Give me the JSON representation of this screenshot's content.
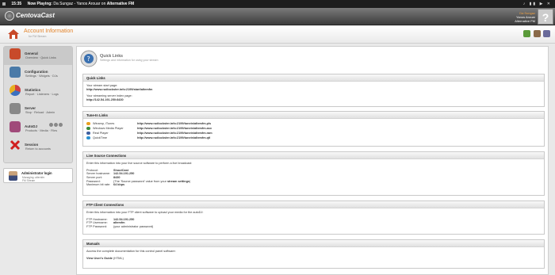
{
  "topbar": {
    "time": "15:35",
    "now_playing_label": "Now Playing:",
    "track": "Da Sungaz - Yanos Arouar on",
    "station": "Alternative FM"
  },
  "header": {
    "logo": "CentovaCast",
    "user_line1": "Da Sungaz",
    "user_line2": "Yanos Arouar",
    "user_line3": "Alternative FM",
    "help": "?"
  },
  "titlebar": {
    "title": "Account Information",
    "subtitle": "for FM Stream"
  },
  "sidebar": {
    "items": [
      {
        "title": "General",
        "links": "Overview  ·  Quick Links"
      },
      {
        "title": "Configuration",
        "links": "Settings  ·  Widgets  ·  DJs"
      },
      {
        "title": "Statistics",
        "links": "Report  ·  Listeners  ·  Logs"
      },
      {
        "title": "Server",
        "links": "Stop  ·  Reload  ·  Admin"
      },
      {
        "title": "AutoDJ",
        "links": "Products  ·  Media  ·  Files"
      },
      {
        "title": "Session",
        "links": "Return to accounts"
      }
    ]
  },
  "admin": {
    "title": "Administrator login",
    "line1": "Managing: alternfm",
    "line2": "FM Stream"
  },
  "page": {
    "title": "Quick Links",
    "subtitle": "Settings and information for using your stream"
  },
  "quick_links": {
    "heading": "Quick Links",
    "start_label": "Your stream start page:",
    "start_url": "http://www.rudiockster.info:2199/start/altemfm",
    "index_label": "Your streaming server index page:",
    "index_url": "http://142.54.191.250:8430"
  },
  "tune_in": {
    "heading": "Tune-In Links",
    "items": [
      {
        "name": "Winamp, iTunes",
        "url": "http://www.rudiockster.info:2199/tunein/altemfm.pls",
        "color": "#e8a020"
      },
      {
        "name": "Windows Media Player",
        "url": "http://www.rudiockster.info:2199/tunein/altemfm.asx",
        "color": "#3a8a3a"
      },
      {
        "name": "Real Player",
        "url": "http://www.rudiockster.info:2199/tunein/altemfm.ram",
        "color": "#4060a0"
      },
      {
        "name": "QuickTime",
        "url": "http://www.rudiockster.info:2199/tunein/altemfm.qtl",
        "color": "#2a90d0"
      }
    ]
  },
  "live_source": {
    "heading": "Live Source Connections",
    "intro": "Enter this information into your live source software to perform a live broadcast:",
    "protocol_label": "Protocol:",
    "protocol": "ShoutCast",
    "hostname_label": "Server hostname:",
    "hostname": "142.54.191.250",
    "port_label": "Server port:",
    "port": "8430",
    "password_label": "Password:",
    "password_pre": "(The 'Source password' value from your",
    "password_link": "stream settings",
    "password_post": ")",
    "bitrate_label": "Maximum bit rate:",
    "bitrate": "64 kbps"
  },
  "ftp": {
    "heading": "FTP Client Connections",
    "intro": "Enter this information into your FTP client software to upload your media for the autoDJ:",
    "host_label": "FTP Hostname:",
    "host": "142.54.191.250",
    "user_label": "FTP Username:",
    "user": "altemfm",
    "pass_label": "FTP Password:",
    "pass": "(your administrator password)"
  },
  "manuals": {
    "heading": "Manuals",
    "intro": "Access the complete documentation for this control panel software:",
    "guide": "View User's Guide",
    "guide_suffix": "(HTML)"
  }
}
